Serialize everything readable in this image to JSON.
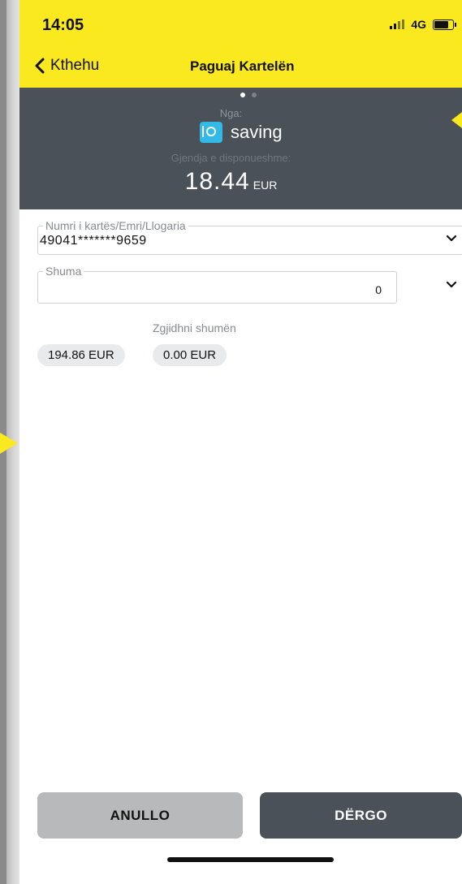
{
  "status_bar": {
    "time": "14:05",
    "network": "4G"
  },
  "nav": {
    "back_label": "Kthehu",
    "title": "Paguaj Kartelën"
  },
  "account": {
    "from_label": "Nga:",
    "name": "saving",
    "available_label": "Gjendja e disponueshme:",
    "balance": "18.44",
    "currency": "EUR",
    "page_count": 2,
    "active_page": 1
  },
  "card_field": {
    "legend": "Numri i kartës/Emri/Llogaria",
    "value": "49041*******9659"
  },
  "amount_field": {
    "legend": "Shuma",
    "value": "0"
  },
  "choose_amount": {
    "label": "Zgjidhni shumën",
    "options": [
      "194.86 EUR",
      "0.00 EUR"
    ]
  },
  "buttons": {
    "cancel": "ANULLO",
    "send": "DËRGO"
  },
  "colors": {
    "brand_yellow": "#fbe91f",
    "panel_dark": "#4a5159",
    "icon_blue": "#33b9e6"
  },
  "icons": {
    "back": "chevron-left-icon",
    "account": "safe-icon",
    "dropdown": "chevron-down-icon"
  }
}
